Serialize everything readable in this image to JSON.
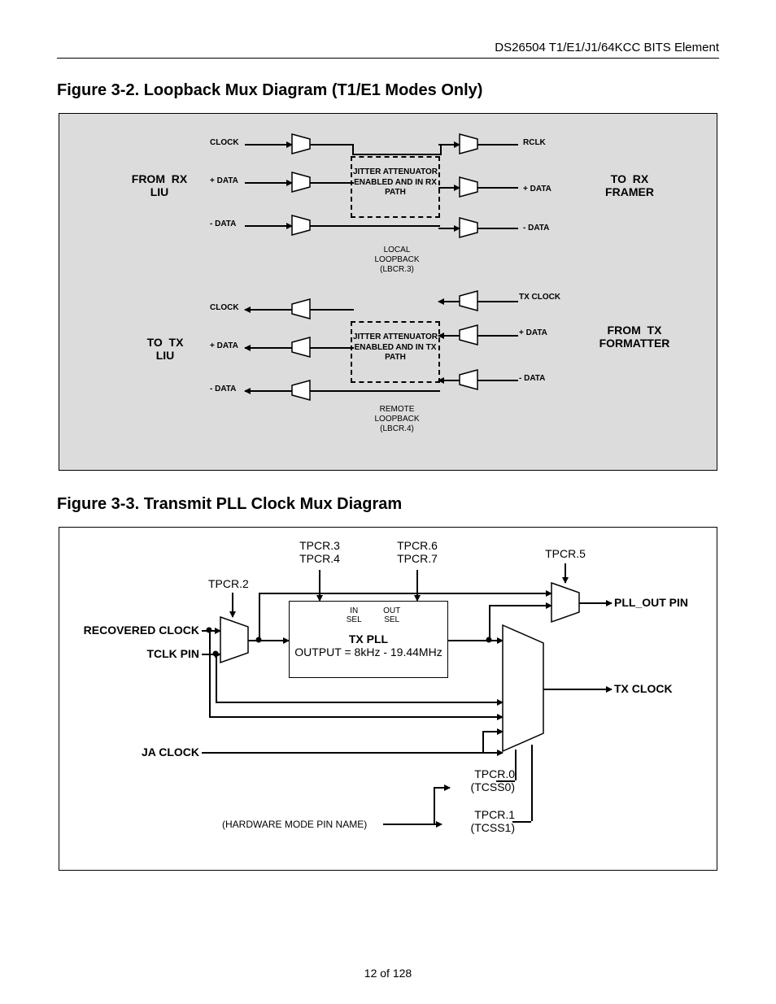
{
  "header": "DS26504 T1/E1/J1/64KCC BITS Element",
  "footer": "12 of 128",
  "fig1": {
    "title": "Figure 3-2. Loopback Mux Diagram (T1/E1 Modes Only)",
    "from_rx": "FROM  RX\nLIU",
    "to_rx": "TO  RX\nFRAMER",
    "to_tx": "TO  TX\nLIU",
    "from_tx": "FROM  TX\nFORMATTER",
    "clock": "CLOCK",
    "pdata": "+ DATA",
    "ndata": "- DATA",
    "rclk": "RCLK",
    "txclock": "TX CLOCK",
    "ja_rx": "JITTER\nATTENUATOR\nENABLED AND\nIN RX PATH",
    "ja_tx": "JITTER\nATTENUATOR\nENABLED AND\nIN TX PATH",
    "local": "LOCAL\nLOOPBACK\n(LBCR.3)",
    "remote": "REMOTE\nLOOPBACK\n(LBCR.4)"
  },
  "fig2": {
    "title": "Figure 3-3. Transmit PLL Clock Mux Diagram",
    "recov": "RECOVERED CLOCK",
    "tclk": "TCLK PIN",
    "ja": "JA CLOCK",
    "tpcr2": "TPCR.2",
    "tpcr34": "TPCR.3\nTPCR.4",
    "tpcr67": "TPCR.6\nTPCR.7",
    "tpcr5": "TPCR.5",
    "insel": "IN\nSEL",
    "outsel": "OUT\nSEL",
    "txpll": "TX PLL",
    "txpll_sub": "OUTPUT = 8kHz -\n19.44MHz",
    "pllout": "PLL_OUT PIN",
    "txclock": "TX CLOCK",
    "tpcr0": "TPCR.0\n(TCSS0)",
    "tpcr1": "TPCR.1\n(TCSS1)",
    "hw": "(HARDWARE MODE PIN NAME)"
  }
}
